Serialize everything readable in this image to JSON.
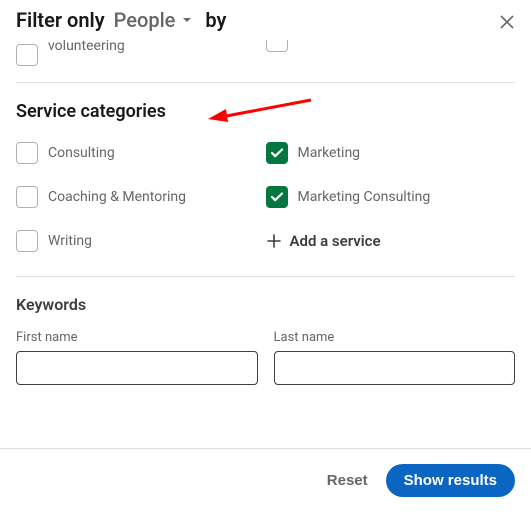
{
  "header": {
    "filter_only": "Filter only",
    "dropdown_value": "People",
    "by": "by"
  },
  "prev_section": {
    "partial_label": "volunteering"
  },
  "service_categories": {
    "title": "Service categories",
    "options": [
      {
        "label": "Consulting",
        "checked": false
      },
      {
        "label": "Marketing",
        "checked": true
      },
      {
        "label": "Coaching & Mentoring",
        "checked": false
      },
      {
        "label": "Marketing Consulting",
        "checked": true
      },
      {
        "label": "Writing",
        "checked": false
      }
    ],
    "add_service": "Add a service"
  },
  "keywords": {
    "title": "Keywords",
    "first_name_label": "First name",
    "last_name_label": "Last name",
    "first_name_value": "",
    "last_name_value": ""
  },
  "footer": {
    "reset": "Reset",
    "show_results": "Show results"
  },
  "colors": {
    "checkbox_checked_bg": "#057642",
    "primary_button_bg": "#0a66c2",
    "annotation_arrow": "#ff0000"
  }
}
